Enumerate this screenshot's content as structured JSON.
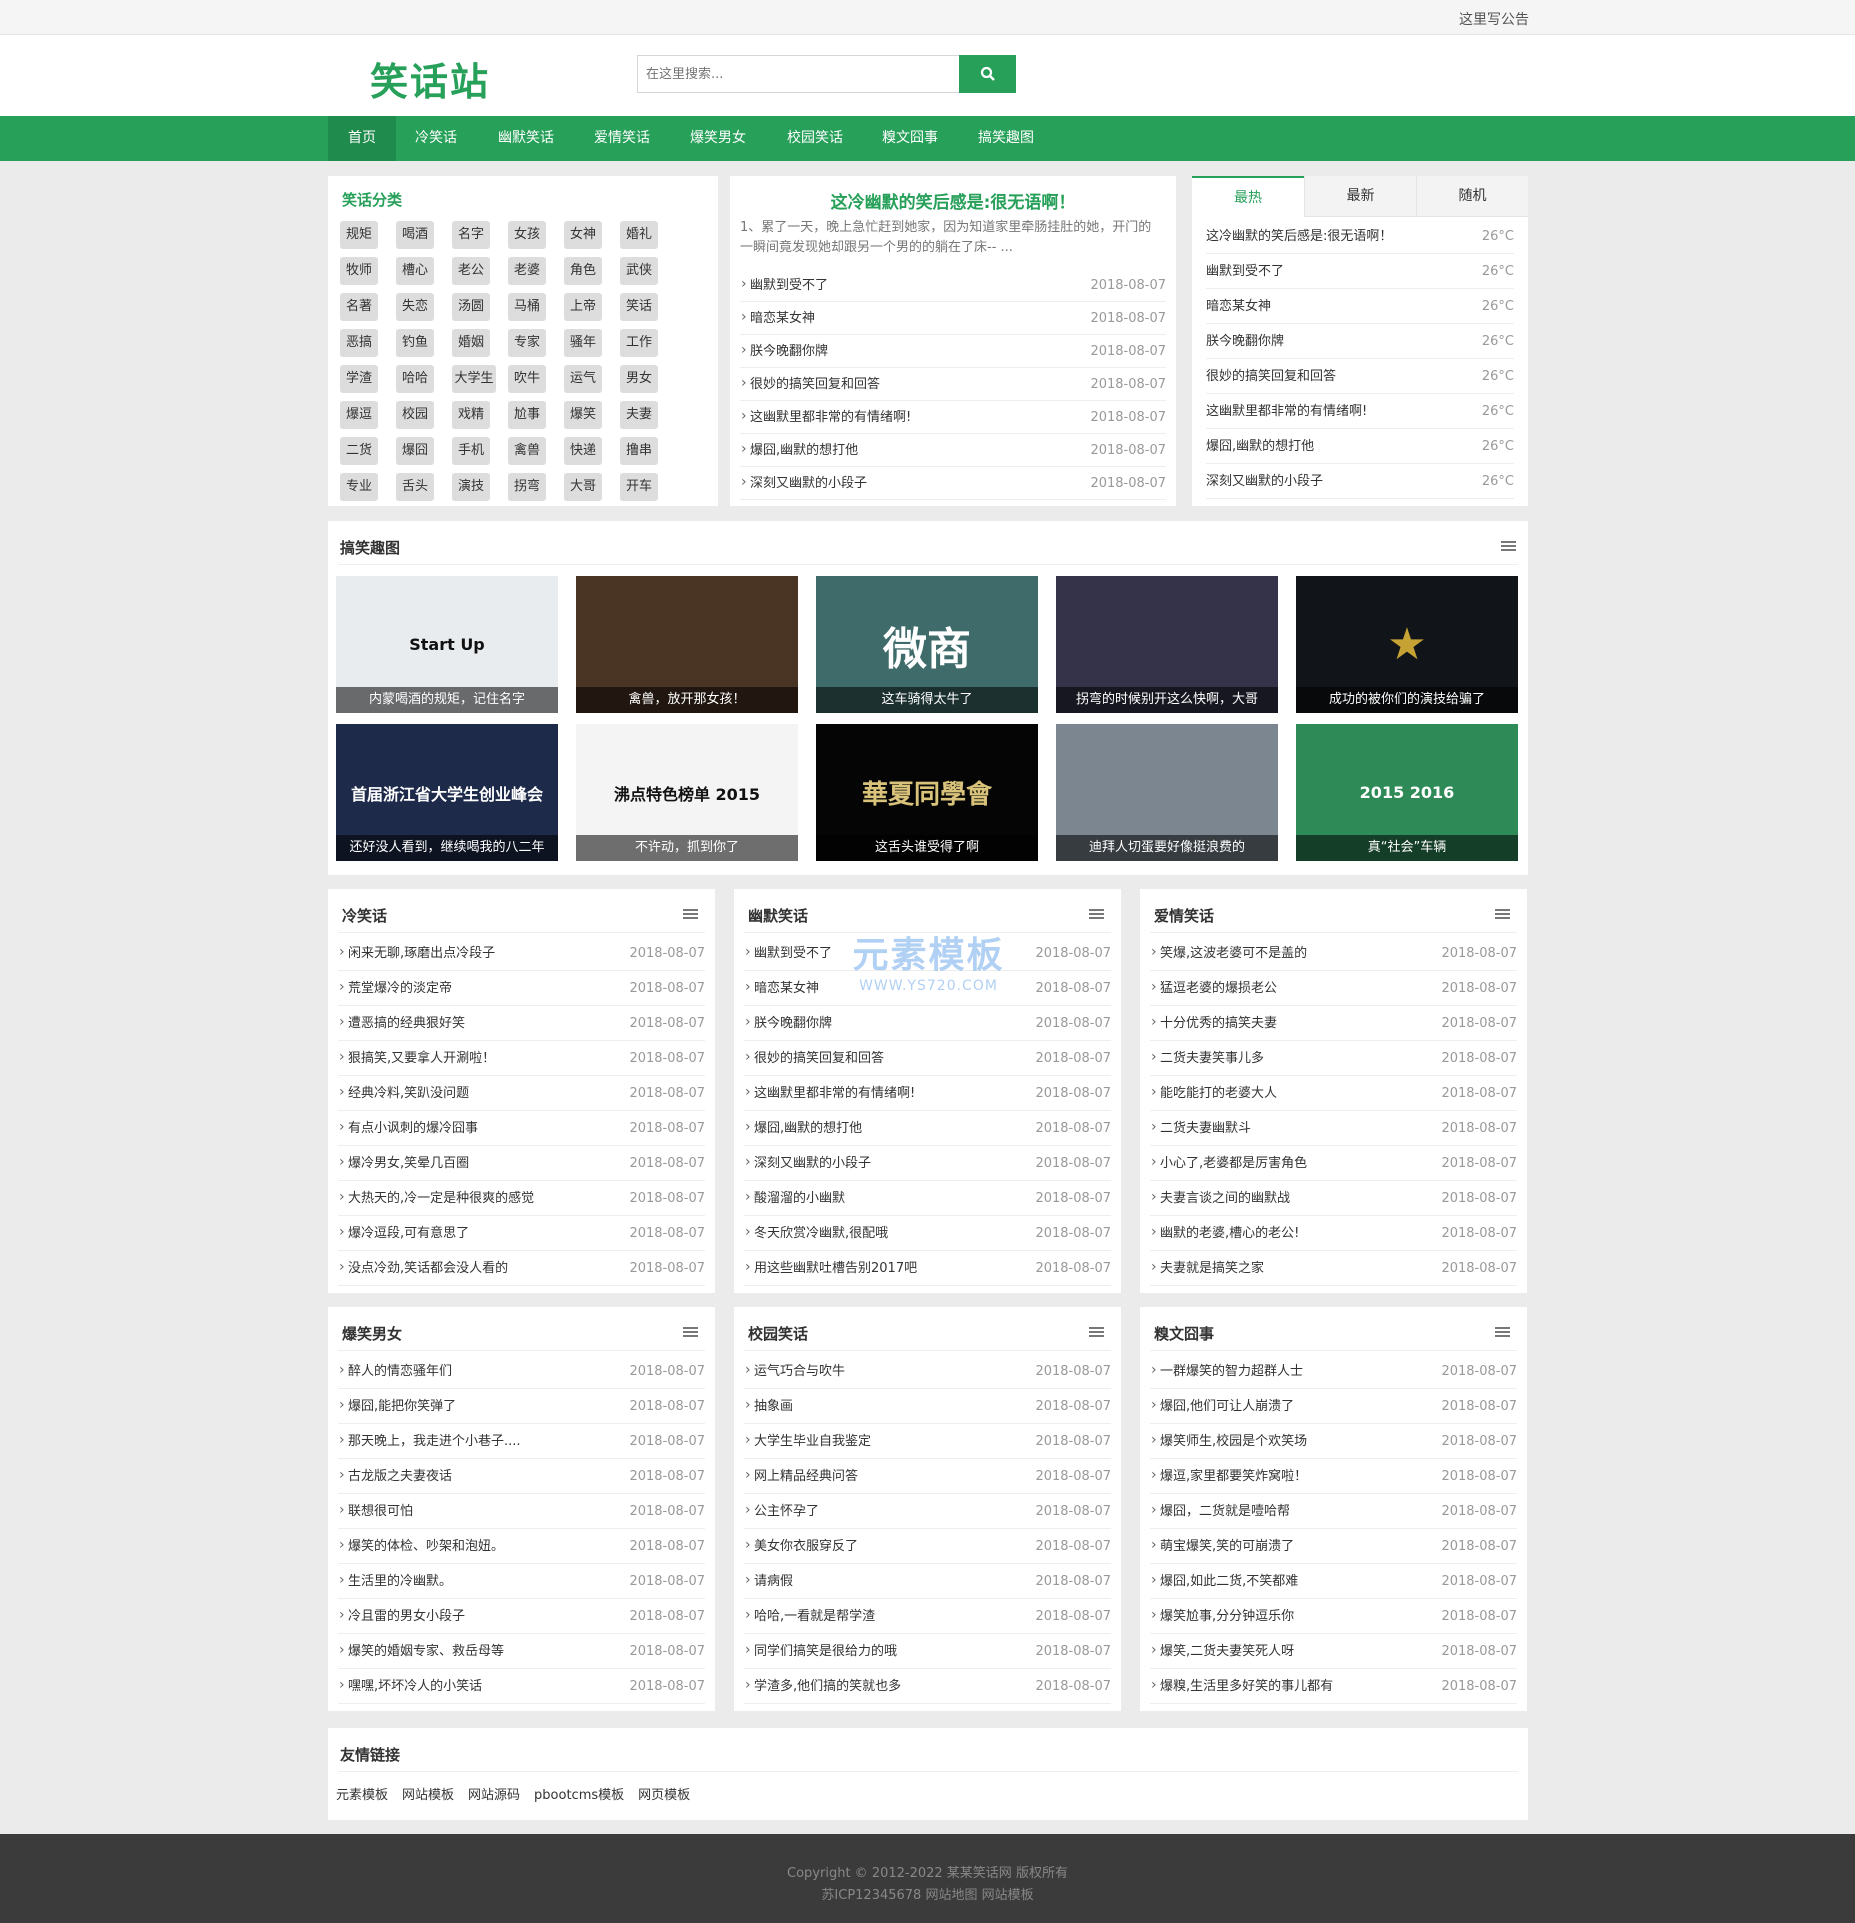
{
  "topbar": {
    "notice": "这里写公告"
  },
  "header": {
    "logo": "笑话站",
    "search_placeholder": "在这里搜索..."
  },
  "nav": [
    "首页",
    "冷笑话",
    "幽默笑话",
    "爱情笑话",
    "爆笑男女",
    "校园笑话",
    "糗文囧事",
    "搞笑趣图"
  ],
  "categories": {
    "title": "笑话分类",
    "tags": [
      "规矩",
      "喝酒",
      "名字",
      "女孩",
      "女神",
      "婚礼",
      "牧师",
      "槽心",
      "老公",
      "老婆",
      "角色",
      "武侠",
      "名著",
      "失恋",
      "汤圆",
      "马桶",
      "上帝",
      "笑话",
      "恶搞",
      "钓鱼",
      "婚姻",
      "专家",
      "骚年",
      "工作",
      "学渣",
      "哈哈",
      "大学生",
      "吹牛",
      "运气",
      "男女",
      "爆逗",
      "校园",
      "戏精",
      "尬事",
      "爆笑",
      "夫妻",
      "二货",
      "爆囧",
      "手机",
      "禽兽",
      "快递",
      "撸串",
      "专业",
      "舌头",
      "演技",
      "拐弯",
      "大哥",
      "开车"
    ]
  },
  "featured": {
    "title": "这冷幽默的笑后感是:很无语啊！",
    "summary": "1、累了一天，晚上急忙赶到她家，因为知道家里牵肠挂肚的她，开门的一瞬间竟发现她却跟另一个男的的躺在了床-- ...",
    "items": [
      {
        "title": "幽默到受不了",
        "date": "2018-08-07"
      },
      {
        "title": "暗恋某女神",
        "date": "2018-08-07"
      },
      {
        "title": "朕今晚翻你牌",
        "date": "2018-08-07"
      },
      {
        "title": "很妙的搞笑回复和回答",
        "date": "2018-08-07"
      },
      {
        "title": "这幽默里都非常的有情绪啊!",
        "date": "2018-08-07"
      },
      {
        "title": "爆囧,幽默的想打他",
        "date": "2018-08-07"
      },
      {
        "title": "深刻又幽默的小段子",
        "date": "2018-08-07"
      }
    ]
  },
  "hot": {
    "tabs": [
      "最热",
      "最新",
      "随机"
    ],
    "items": [
      {
        "title": "这冷幽默的笑后感是:很无语啊！",
        "temp": "26°C"
      },
      {
        "title": "幽默到受不了",
        "temp": "26°C"
      },
      {
        "title": "暗恋某女神",
        "temp": "26°C"
      },
      {
        "title": "朕今晚翻你牌",
        "temp": "26°C"
      },
      {
        "title": "很妙的搞笑回复和回答",
        "temp": "26°C"
      },
      {
        "title": "这幽默里都非常的有情绪啊!",
        "temp": "26°C"
      },
      {
        "title": "爆囧,幽默的想打他",
        "temp": "26°C"
      },
      {
        "title": "深刻又幽默的小段子",
        "temp": "26°C"
      }
    ]
  },
  "gallery": {
    "title": "搞笑趣图",
    "items": [
      {
        "caption": "内蒙喝酒的规矩，记住名字",
        "art": "Start Up",
        "bg": "#e9ecef",
        "fg": "#111"
      },
      {
        "caption": "禽兽，放开那女孩！",
        "art": "",
        "bg": "#4a3424",
        "fg": "#fff"
      },
      {
        "caption": "这车骑得太牛了",
        "art": "微商",
        "bg": "#3f6b6b",
        "fg": "#fff"
      },
      {
        "caption": "拐弯的时候别开这么快啊，大哥",
        "art": "",
        "bg": "#34334a",
        "fg": "#fff"
      },
      {
        "caption": "成功的被你们的演技给骗了",
        "art": "★",
        "bg": "#111418",
        "fg": "#c6a133"
      },
      {
        "caption": "还好没人看到，继续喝我的八二年",
        "art": "首届浙江省大学生创业峰会",
        "bg": "#1d2a4a",
        "fg": "#fff"
      },
      {
        "caption": "不许动，抓到你了",
        "art": "沸点特色榜单 2015",
        "bg": "#f4f4f4",
        "fg": "#111"
      },
      {
        "caption": "这舌头谁受得了啊",
        "art": "華夏同學會",
        "bg": "#050505",
        "fg": "#d9c27a"
      },
      {
        "caption": "迪拜人切蛋要好像挺浪费的",
        "art": "",
        "bg": "#7b8690",
        "fg": "#fff"
      },
      {
        "caption": "真“社会”车辆",
        "art": "2015 2016",
        "bg": "#2e8b57",
        "fg": "#fff"
      }
    ]
  },
  "lists": [
    {
      "title": "冷笑话",
      "items": [
        "闲来无聊,琢磨出点冷段子",
        "荒堂爆冷的淡定帝",
        "遭恶搞的经典狠好笑",
        "狠搞笑,又要拿人开涮啦！",
        "经典冷料,笑趴没问题",
        "有点小讽刺的爆冷囧事",
        "爆冷男女,笑晕几百圈",
        "大热天的,冷一定是种很爽的感觉",
        "爆冷逗段,可有意思了",
        "没点冷劲,笑话都会没人看的"
      ]
    },
    {
      "title": "幽默笑话",
      "items": [
        "幽默到受不了",
        "暗恋某女神",
        "朕今晚翻你牌",
        "很妙的搞笑回复和回答",
        "这幽默里都非常的有情绪啊!",
        "爆囧,幽默的想打他",
        "深刻又幽默的小段子",
        "酸溜溜的小幽默",
        "冬天欣赏冷幽默,很配哦",
        "用这些幽默吐槽告别2017吧"
      ]
    },
    {
      "title": "爱情笑话",
      "items": [
        "笑爆,这波老婆可不是盖的",
        "猛逗老婆的爆损老公",
        "十分优秀的搞笑夫妻",
        "二货夫妻笑事儿多",
        "能吃能打的老婆大人",
        "二货夫妻幽默斗",
        "小心了,老婆都是厉害角色",
        "夫妻言谈之间的幽默战",
        "幽默的老婆,槽心的老公!",
        "夫妻就是搞笑之家"
      ]
    },
    {
      "title": "爆笑男女",
      "items": [
        "醉人的情恋骚年们",
        "爆囧,能把你笑弹了",
        "那天晚上，我走进个小巷子....",
        "古龙版之夫妻夜话",
        "联想很可怕",
        "爆笑的体检、吵架和泡妞。",
        "生活里的冷幽默。",
        "冷且雷的男女小段子",
        "爆笑的婚姻专家、救岳母等",
        "嘿嘿,坏坏冷人的小笑话"
      ]
    },
    {
      "title": "校园笑话",
      "items": [
        "运气巧合与吹牛",
        "抽象画",
        "大学生毕业自我鉴定",
        "网上精品经典问答",
        "公主怀孕了",
        "美女你衣服穿反了",
        "请病假",
        "哈哈,一看就是帮学渣",
        "同学们搞笑是很给力的哦",
        "学渣多,他们搞的笑就也多"
      ]
    },
    {
      "title": "糗文囧事",
      "items": [
        "一群爆笑的智力超群人士",
        "爆囧,他们可让人崩溃了",
        "爆笑师生,校园是个欢笑场",
        "爆逗,家里都要笑炸窝啦！",
        "爆囧，二货就是噎哈帮",
        "萌宝爆笑,笑的可崩溃了",
        "爆囧,如此二货,不笑都难",
        "爆笑尬事,分分钟逗乐你",
        "爆笑,二货夫妻笑死人呀",
        "爆糗,生活里多好笑的事儿都有"
      ]
    }
  ],
  "list_date": "2018-08-07",
  "links": {
    "title": "友情链接",
    "items": [
      "元素模板",
      "网站模板",
      "网站源码",
      "pbootcms模板",
      "网页模板"
    ]
  },
  "watermark": {
    "text": "元素模板",
    "url": "WWW.YS720.COM"
  },
  "footer": {
    "line1": "Copyright © 2012-2022 某某笑话网 版权所有",
    "line2": "苏ICP12345678 网站地图 网站模板"
  },
  "colors": {
    "brand": "#27a05a",
    "brand_dark": "#1f8b4c"
  }
}
